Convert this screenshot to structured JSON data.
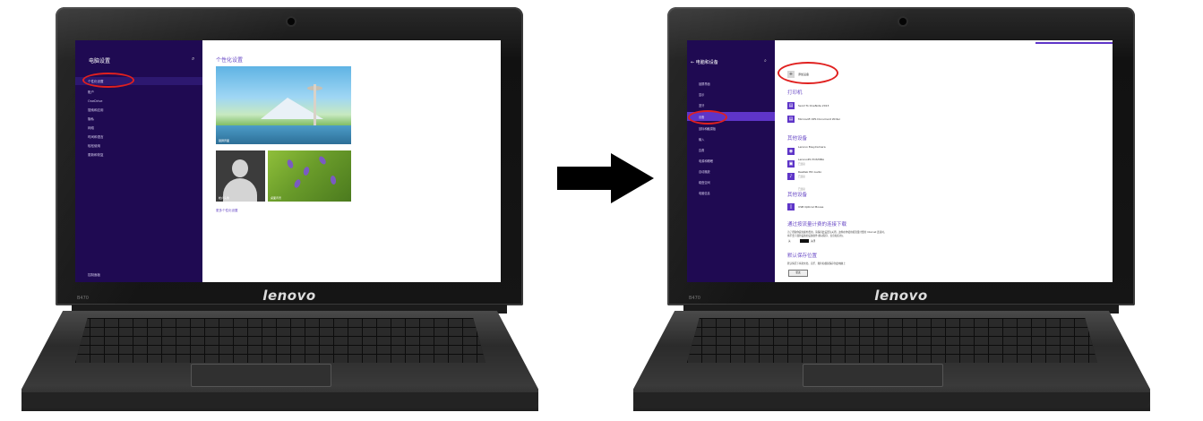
{
  "left_laptop": {
    "sidebar": {
      "title": "电脑设置",
      "search_icon": "⌕",
      "items": [
        "个性化设置",
        "账户",
        "OneDrive",
        "搜索和应用",
        "隐私",
        "网络",
        "时间和语言",
        "轻松使用",
        "更新和恢复"
      ],
      "selected_index": 0,
      "bottom_item": "控制面板"
    },
    "content": {
      "heading": "个性化设置",
      "tiles": {
        "lock_screen_caption": "锁屏界面",
        "account_caption": "帐户头像",
        "background_caption": "桌面背景"
      },
      "link": "更多个性化设置"
    },
    "model_label": "B470",
    "brand": "lenovo"
  },
  "right_laptop": {
    "sidebar": {
      "title": "电脑和设备",
      "back_icon": "←",
      "search_icon": "⌕",
      "items": [
        "锁屏界面",
        "显示",
        "蓝牙",
        "设备",
        "鼠标和触摸板",
        "输入",
        "边角",
        "电源和睡眠",
        "自动播放",
        "磁盘空间",
        "电脑信息"
      ],
      "selected_index": 3
    },
    "content": {
      "add_device_label": "添加设备",
      "add_device_icon": "+",
      "sections": [
        {
          "heading": "打印机",
          "devices": [
            {
              "name": "Send To OneNote 2013",
              "status": ""
            },
            {
              "name": "Microsoft XPS Document Writer",
              "status": ""
            }
          ]
        },
        {
          "heading": "其他设备",
          "devices": [
            {
              "name": "Lenovo EasyCamera",
              "status": "已连接"
            },
            {
              "name": "LenovoPC-TOSHIBA",
              "status": "已连接"
            },
            {
              "name": "Realtek HD Audio",
              "status": "已连接"
            }
          ]
        },
        {
          "heading": "其他设备",
          "devices": [
            {
              "name": "USB Optical Mouse",
              "status": ""
            }
          ]
        }
      ],
      "metered": {
        "heading": "通过按流量计费的连接下载",
        "text_line1": "为了帮助你避免额外费用，请保持此设置为关闭，这样在你使用按流量计费的 Internet 连接时，",
        "text_line2": "将不会下载新设备的设备软件(驱动程序、信息和应用)。",
        "toggle_state": "关",
        "toggle_label": "关闭"
      },
      "default_save": {
        "heading": "默认保存位置",
        "text": "默认情况下将新文档、音乐、图片和视频保存到此电脑上",
        "button_label": "更改"
      }
    },
    "model_label": "B470",
    "brand": "lenovo"
  },
  "colors": {
    "sidebar_bg": "#1f0a52",
    "accent": "#5e35c8",
    "heading": "#6a4bc6",
    "highlight_ring": "#e0201f",
    "arrow": "#000000"
  }
}
